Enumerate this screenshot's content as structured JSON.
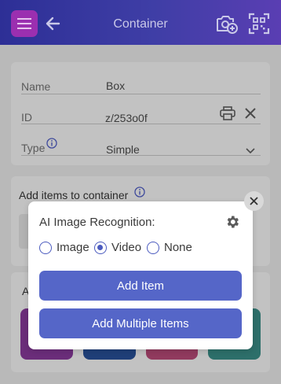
{
  "appbar": {
    "title": "Container"
  },
  "form": {
    "name_label": "Name",
    "name_value": "Box",
    "id_label": "ID",
    "id_value": "z/253o0f",
    "type_label": "Type",
    "type_value": "Simple"
  },
  "sections": {
    "add_items_title": "Add items to container",
    "second_section_letter": "A"
  },
  "modal": {
    "title": "AI Image Recognition:",
    "options": [
      {
        "label": "Image",
        "checked": false
      },
      {
        "label": "Video",
        "checked": true
      },
      {
        "label": "None",
        "checked": false
      }
    ],
    "add_item_label": "Add Item",
    "add_multiple_label": "Add Multiple Items"
  },
  "colors": {
    "appbar_start": "#2d2f96",
    "appbar_end": "#5a3eb3",
    "menu_button": "#9b2fb0",
    "primary_button": "#5566c8",
    "radio_accent": "#4b5bbf"
  }
}
